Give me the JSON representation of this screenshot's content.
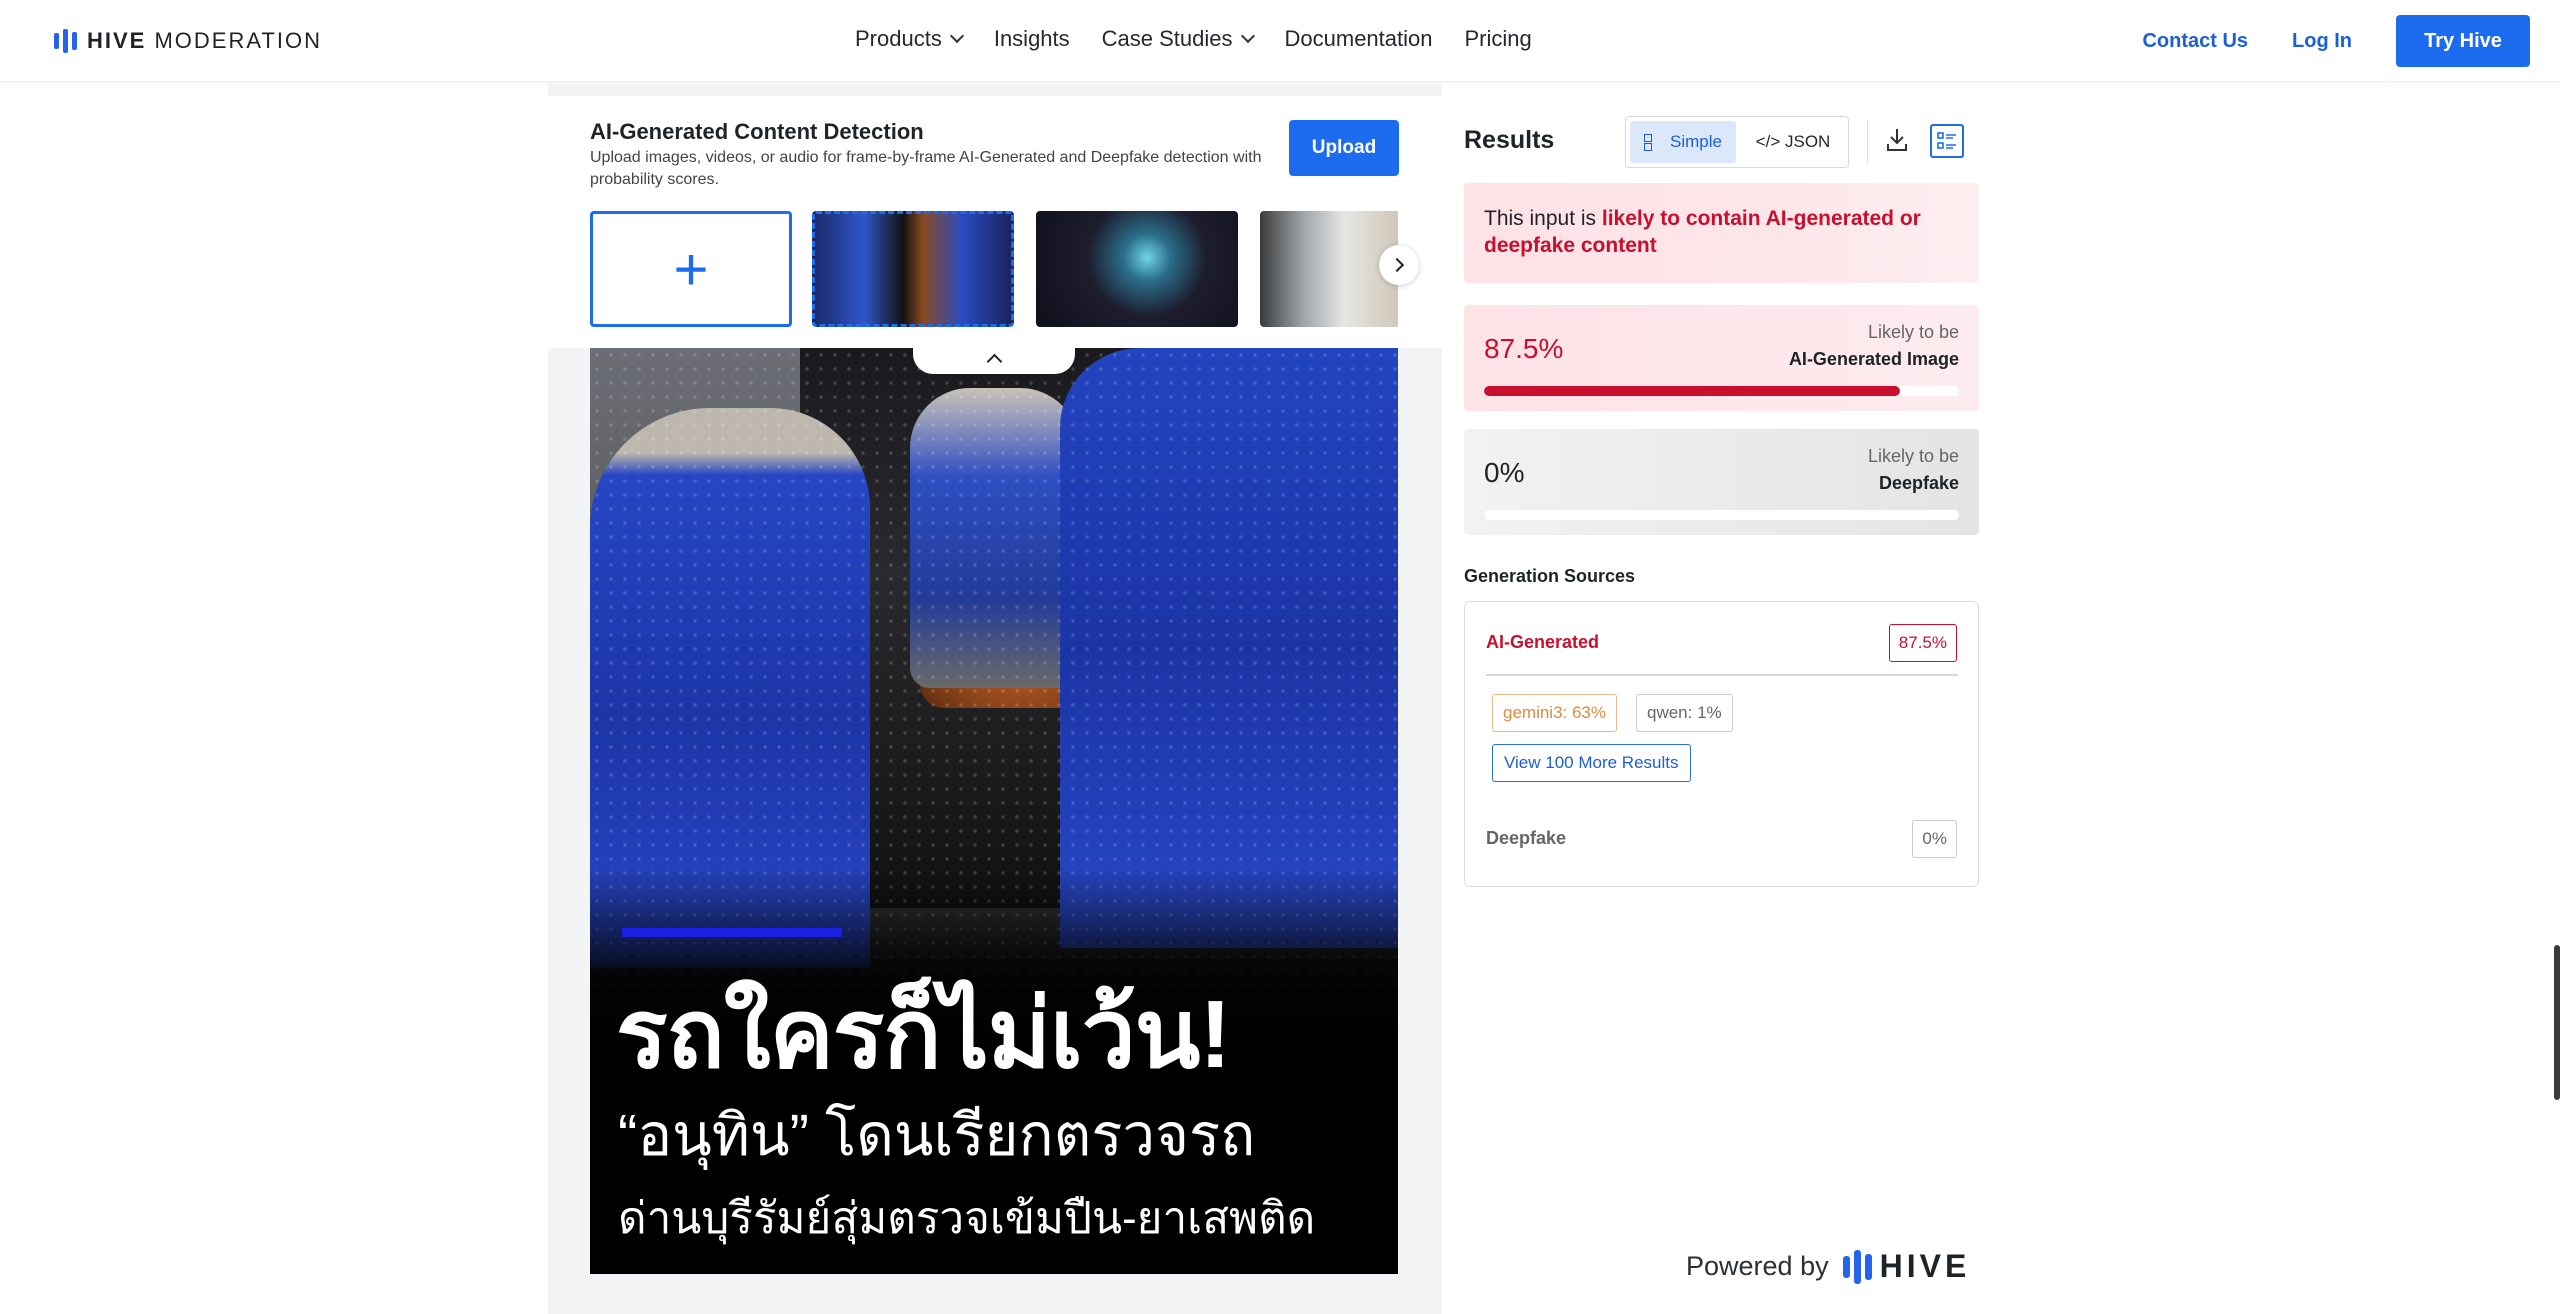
{
  "brand": {
    "name_bold": "HIVE",
    "name_light": "MODERATION",
    "accent": "#1d6cf0",
    "alert": "#c8102e"
  },
  "nav": {
    "items": [
      {
        "label": "Products",
        "has_dropdown": true
      },
      {
        "label": "Insights",
        "has_dropdown": false
      },
      {
        "label": "Case Studies",
        "has_dropdown": true
      },
      {
        "label": "Documentation",
        "has_dropdown": false
      },
      {
        "label": "Pricing",
        "has_dropdown": false
      }
    ],
    "contact": "Contact Us",
    "login": "Log In",
    "try": "Try Hive"
  },
  "upload": {
    "title": "AI-Generated Content Detection",
    "description": "Upload images, videos, or audio for frame-by-frame AI-Generated and Deepfake detection with probability scores.",
    "button": "Upload",
    "add_symbol": "+"
  },
  "main_image": {
    "headline": "รถใครก็ไม่เว้น!",
    "line2": "“อนุทิน” โดนเรียกตรวจรถ",
    "line3": "ด่านบุรีรัมย์สุ่มตรวจเข้มปืน-ยาเสพติด"
  },
  "results": {
    "title": "Results",
    "toggle": {
      "simple": "Simple",
      "json": "</> JSON",
      "selected": "Simple"
    },
    "verdict_prefix": "This input is ",
    "verdict_emphasis": "likely to contain AI-generated or deepfake content",
    "scores": [
      {
        "percent_text": "87.5%",
        "value": 0.875,
        "likely": "Likely to be",
        "label": "AI-Generated Image"
      },
      {
        "percent_text": "0%",
        "value": 0.0,
        "likely": "Likely to be",
        "label": "Deepfake"
      }
    ],
    "sources": {
      "title": "Generation Sources",
      "ai_label": "AI-Generated",
      "ai_value": "87.5%",
      "chips": [
        {
          "label": "gemini3: 63%"
        },
        {
          "label": "qwen: 1%"
        }
      ],
      "more_button": "View 100 More Results",
      "deepfake_label": "Deepfake",
      "deepfake_value": "0%"
    }
  },
  "footer": {
    "powered_by": "Powered by",
    "logo_word": "HIVE"
  }
}
